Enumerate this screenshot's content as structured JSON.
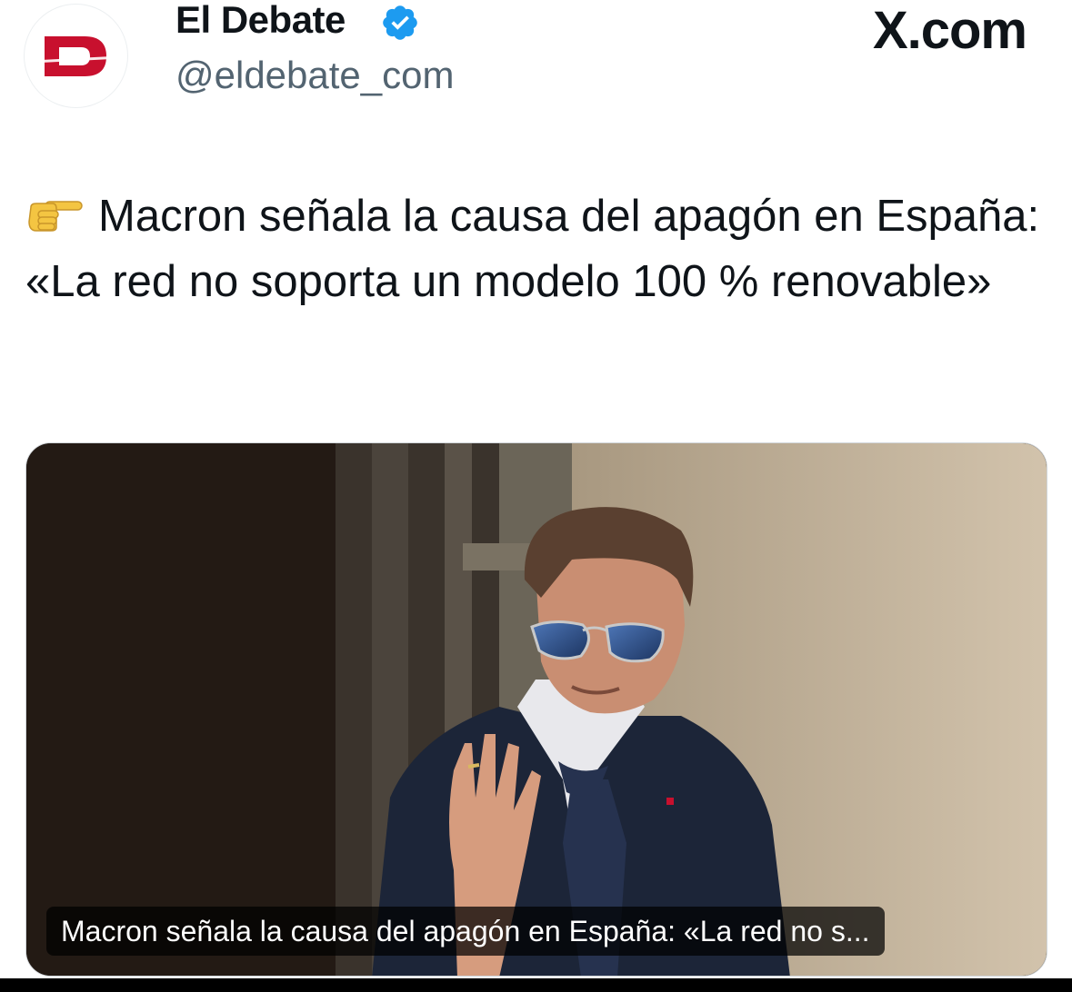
{
  "author": {
    "name": "El Debate",
    "handle": "@eldebate_com",
    "avatar_letter": "D",
    "brand_color": "#c8102e",
    "verified_color": "#1d9bf0"
  },
  "platform": {
    "logo_text": "X.com"
  },
  "tweet": {
    "emoji_icon": "backhand-index-pointing-right",
    "text": "Macron señala la causa del apagón en España: «La red no soporta un modelo 100 % renovable»"
  },
  "media": {
    "caption": "Macron señala la causa del apagón en España: «La red no s..."
  }
}
